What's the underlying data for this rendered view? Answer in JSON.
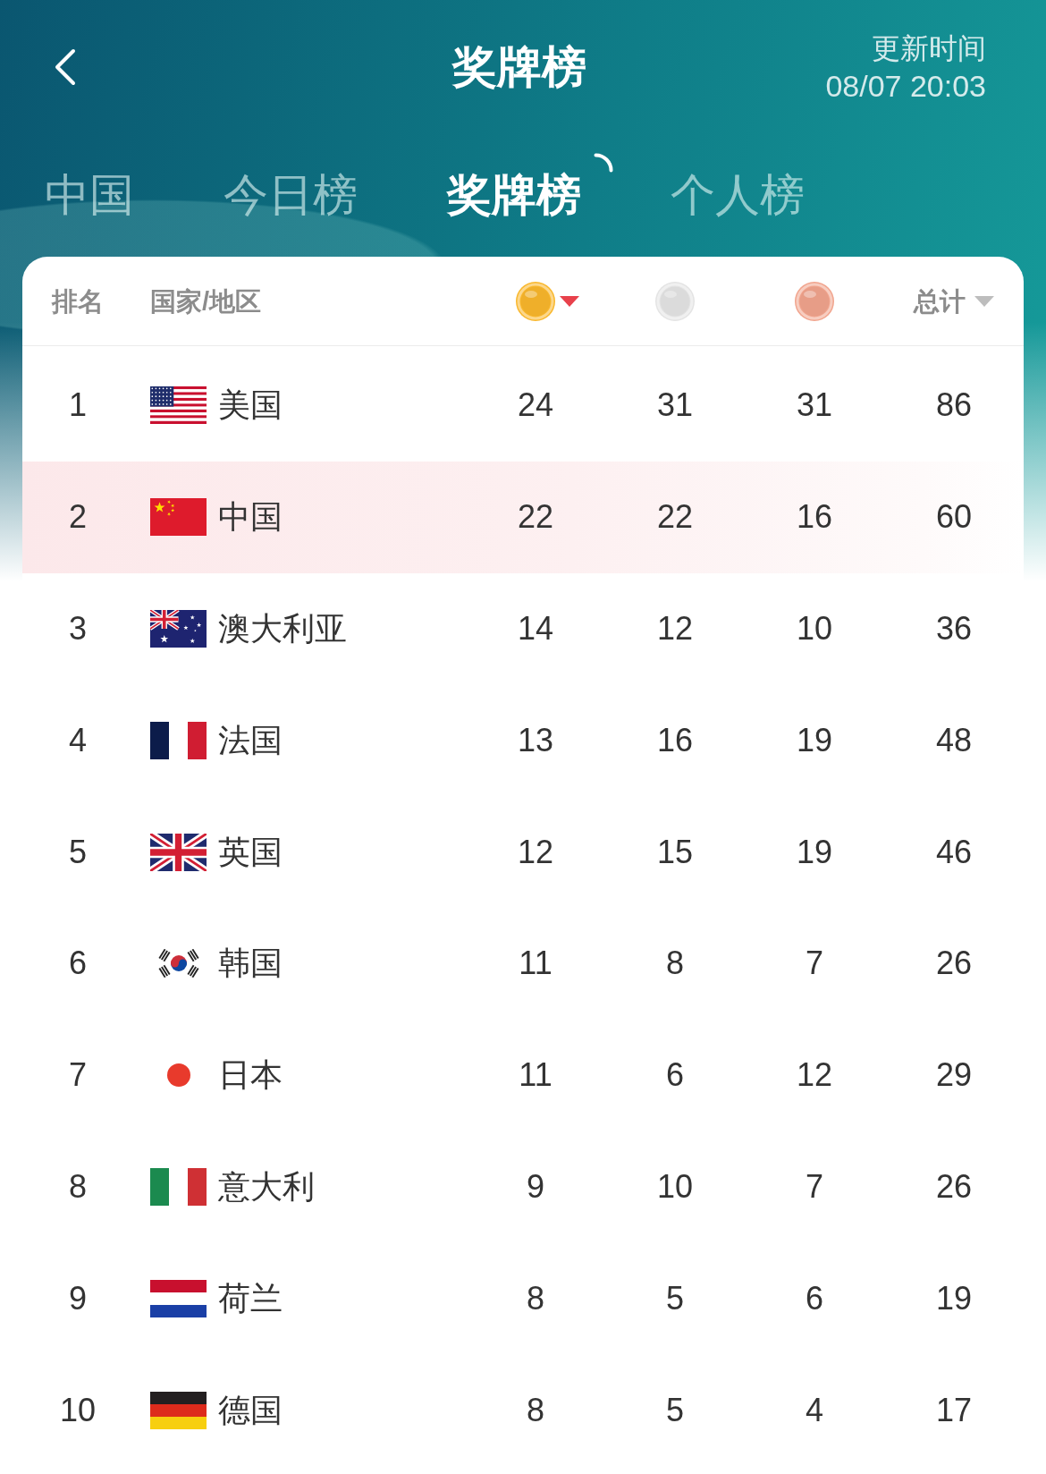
{
  "header": {
    "title": "奖牌榜",
    "update_label": "更新时间",
    "update_time": "08/07 20:03"
  },
  "tabs": [
    {
      "label": "中国",
      "selected": false
    },
    {
      "label": "今日榜",
      "selected": false
    },
    {
      "label": "奖牌榜",
      "selected": true
    },
    {
      "label": "个人榜",
      "selected": false
    }
  ],
  "table": {
    "columns": [
      {
        "kind": "text",
        "label": "排名",
        "sortable": false,
        "selected": false
      },
      {
        "kind": "text",
        "label": "国家/地区",
        "sortable": false,
        "selected": false
      },
      {
        "kind": "medal",
        "color": "#f9b72c",
        "sortable": true,
        "selected": true
      },
      {
        "kind": "medal",
        "color": "#e4e4e4",
        "sortable": false,
        "selected": false
      },
      {
        "kind": "medal",
        "color": "#f1a48d",
        "sortable": false,
        "selected": false
      },
      {
        "kind": "text",
        "label": "总计",
        "sortable": true,
        "selected": false
      }
    ],
    "rows": [
      {
        "rank": "1",
        "kind": "us",
        "country": "美国",
        "gold": "24",
        "silver": "31",
        "bronze": "31",
        "total": "86",
        "highlighted": false
      },
      {
        "rank": "2",
        "kind": "cn",
        "country": "中国",
        "gold": "22",
        "silver": "22",
        "bronze": "16",
        "total": "60",
        "highlighted": true
      },
      {
        "rank": "3",
        "kind": "au",
        "country": "澳大利亚",
        "gold": "14",
        "silver": "12",
        "bronze": "10",
        "total": "36",
        "highlighted": false
      },
      {
        "rank": "4",
        "kind": "fr",
        "country": "法国",
        "gold": "13",
        "silver": "16",
        "bronze": "19",
        "total": "48",
        "highlighted": false
      },
      {
        "rank": "5",
        "kind": "gb",
        "country": "英国",
        "gold": "12",
        "silver": "15",
        "bronze": "19",
        "total": "46",
        "highlighted": false
      },
      {
        "rank": "6",
        "kind": "kr",
        "country": "韩国",
        "gold": "11",
        "silver": "8",
        "bronze": "7",
        "total": "26",
        "highlighted": false
      },
      {
        "rank": "7",
        "kind": "jp",
        "country": "日本",
        "gold": "11",
        "silver": "6",
        "bronze": "12",
        "total": "29",
        "highlighted": false
      },
      {
        "rank": "8",
        "kind": "it",
        "country": "意大利",
        "gold": "9",
        "silver": "10",
        "bronze": "7",
        "total": "26",
        "highlighted": false
      },
      {
        "rank": "9",
        "kind": "nl",
        "country": "荷兰",
        "gold": "8",
        "silver": "5",
        "bronze": "6",
        "total": "19",
        "highlighted": false
      },
      {
        "rank": "10",
        "kind": "de",
        "country": "德国",
        "gold": "8",
        "silver": "5",
        "bronze": "4",
        "total": "17",
        "highlighted": false
      }
    ]
  }
}
